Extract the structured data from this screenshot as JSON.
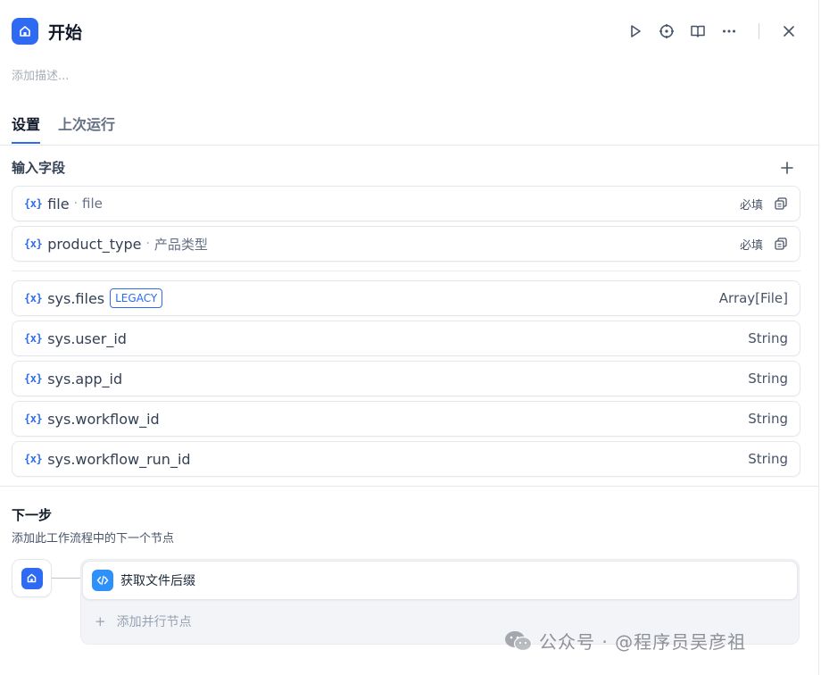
{
  "header": {
    "title": "开始"
  },
  "description_placeholder": "添加描述...",
  "tabs": [
    {
      "label": "设置",
      "active": true
    },
    {
      "label": "上次运行",
      "active": false
    }
  ],
  "input_section": {
    "title": "输入字段"
  },
  "user_variables": [
    {
      "prefix": "{x}",
      "name": "file",
      "separator": "·",
      "label": "file",
      "required": "必填"
    },
    {
      "prefix": "{x}",
      "name": "product_type",
      "separator": "·",
      "label": "产品类型",
      "required": "必填"
    }
  ],
  "system_variables": [
    {
      "prefix": "{x}",
      "name": "sys.files",
      "badge": "LEGACY",
      "type": "Array[File]"
    },
    {
      "prefix": "{x}",
      "name": "sys.user_id",
      "type": "String"
    },
    {
      "prefix": "{x}",
      "name": "sys.app_id",
      "type": "String"
    },
    {
      "prefix": "{x}",
      "name": "sys.workflow_id",
      "type": "String"
    },
    {
      "prefix": "{x}",
      "name": "sys.workflow_run_id",
      "type": "String"
    }
  ],
  "next_step": {
    "title": "下一步",
    "subtitle": "添加此工作流程中的下一个节点",
    "node_label": "获取文件后缀",
    "add_parallel": "添加并行节点",
    "add_parallel_plus": "+"
  },
  "watermark": {
    "text": "公众号 · @程序员吴彦祖"
  },
  "colors": {
    "accent": "#2e6bf2",
    "code_node": "#2e90fa"
  },
  "icons": {
    "app": "home-icon",
    "run": "play-icon",
    "locate": "crosshair-icon",
    "docs": "book-icon",
    "more": "more-horizontal-icon",
    "close": "close-icon",
    "add": "plus-icon",
    "copy": "copy-icon",
    "code": "code-icon"
  }
}
